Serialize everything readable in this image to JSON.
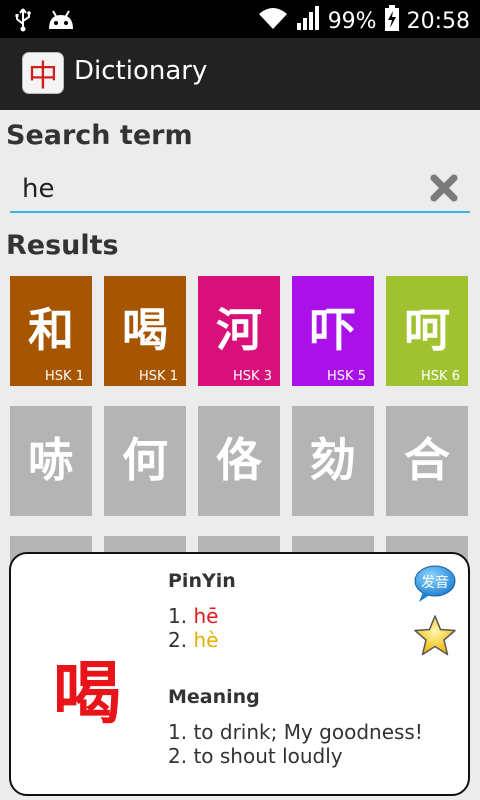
{
  "status_bar": {
    "battery": "99%",
    "time": "20:58",
    "icons": [
      "usb-icon",
      "android-debug-icon",
      "wifi-icon",
      "signal-icon",
      "battery-charging-icon"
    ]
  },
  "action_bar": {
    "app_icon_glyph": "中",
    "title": "Dictionary"
  },
  "search": {
    "label": "Search term",
    "value": "he",
    "clear_icon": "clear-icon",
    "underline_color": "#33b5e5"
  },
  "results": {
    "label": "Results",
    "row1": [
      {
        "char": "和",
        "level": "HSK 1",
        "color": "#a65500"
      },
      {
        "char": "喝",
        "level": "HSK 1",
        "color": "#a65500"
      },
      {
        "char": "河",
        "level": "HSK 3",
        "color": "#d8107a"
      },
      {
        "char": "吓",
        "level": "HSK 5",
        "color": "#aa11e8"
      },
      {
        "char": "呵",
        "level": "HSK 6",
        "color": "#a0c230"
      }
    ],
    "row2": [
      {
        "char": "哧",
        "color": "#b4b4b4"
      },
      {
        "char": "何",
        "color": "#b4b4b4"
      },
      {
        "char": "佫",
        "color": "#b4b4b4"
      },
      {
        "char": "劾",
        "color": "#b4b4b4"
      },
      {
        "char": "合",
        "color": "#b4b4b4"
      }
    ]
  },
  "popup": {
    "character": "喝",
    "pinyin_label": "PinYin",
    "pinyin": [
      {
        "num": "1.",
        "text": "hē"
      },
      {
        "num": "2.",
        "text": "hè"
      }
    ],
    "meaning_label": "Meaning",
    "meanings": [
      "1. to drink; My goodness!",
      "2. to shout loudly"
    ],
    "audio_label": "发音",
    "audio_icon": "speech-bubble-icon",
    "favorite_icon": "star-icon"
  }
}
